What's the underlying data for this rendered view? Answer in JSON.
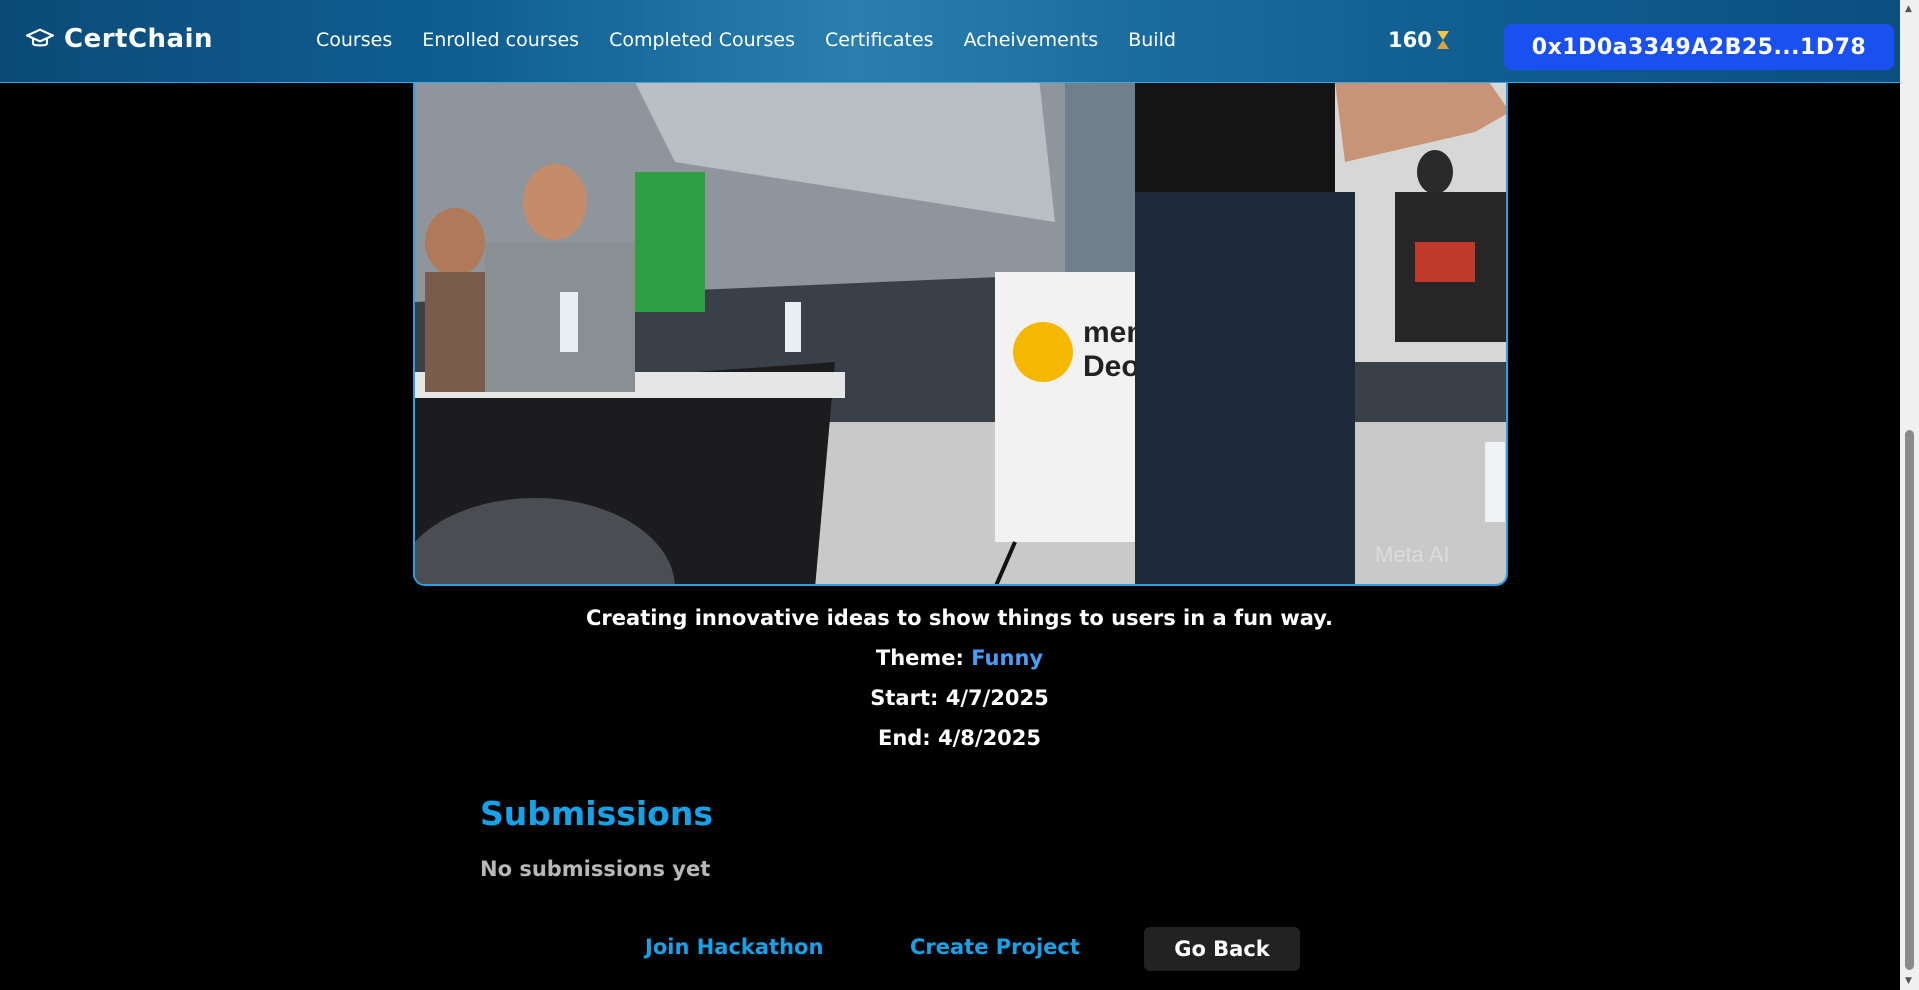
{
  "header": {
    "brand": "CertChain",
    "nav": [
      "Courses",
      "Enrolled courses",
      "Completed Courses",
      "Certificates",
      "Acheivements",
      "Build"
    ],
    "points": "160",
    "wallet": "0x1D0a3349A2B25...1D78"
  },
  "hackathon": {
    "description": "Creating innovative ideas to show things to users in a fun way.",
    "theme_label": "Theme:",
    "theme_value": "Funny",
    "start": "Start: 4/7/2025",
    "end": "End: 4/8/2025",
    "image_text": "memi Deotk",
    "image_caption": "Meta AI"
  },
  "submissions": {
    "title": "Submissions",
    "empty": "No submissions yet"
  },
  "actions": {
    "join": "Join Hackathon",
    "create": "Create Project",
    "back": "Go Back"
  },
  "colors": {
    "accent": "#17a2e8",
    "wallet": "#1a4ff0",
    "theme": "#4a9cf5"
  }
}
